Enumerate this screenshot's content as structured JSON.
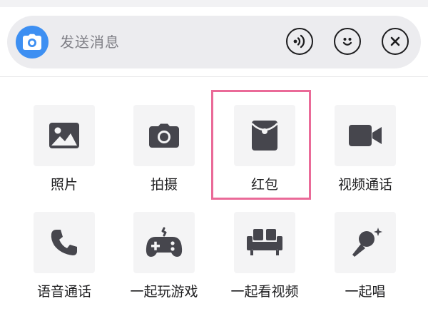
{
  "input_bar": {
    "placeholder": "发送消息",
    "icons": [
      "camera-icon",
      "voice-wave-icon",
      "smiley-icon",
      "close-circle-icon"
    ]
  },
  "panel": {
    "items": [
      {
        "label": "照片",
        "icon": "photo-icon"
      },
      {
        "label": "拍摄",
        "icon": "camera-shoot-icon"
      },
      {
        "label": "红包",
        "icon": "red-envelope-icon",
        "highlighted": true
      },
      {
        "label": "视频通话",
        "icon": "video-call-icon"
      },
      {
        "label": "语音通话",
        "icon": "phone-icon"
      },
      {
        "label": "一起玩游戏",
        "icon": "gamepad-icon"
      },
      {
        "label": "一起看视频",
        "icon": "sofa-icon"
      },
      {
        "label": "一起唱",
        "icon": "microphone-icon"
      }
    ]
  },
  "colors": {
    "camera_button": "#3d8ff2",
    "icon_dark": "#46464d",
    "tile_bg": "#f4f4f5",
    "highlight": "#ea6a98"
  }
}
